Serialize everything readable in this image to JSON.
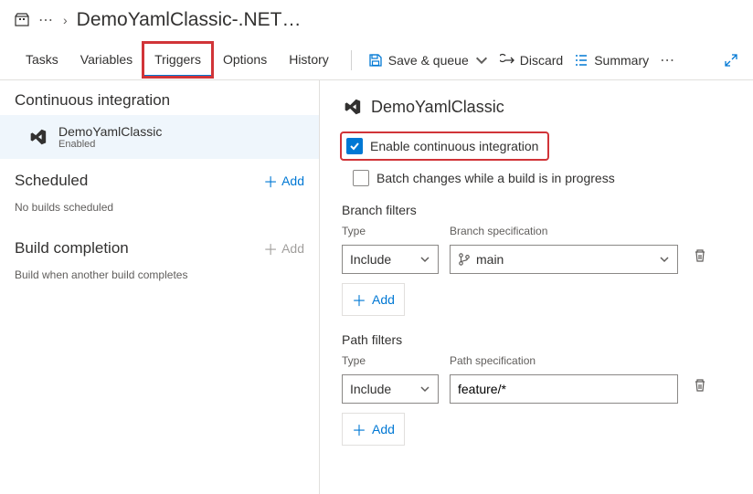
{
  "breadcrumb": {
    "title": "DemoYamlClassic-.NET…"
  },
  "tabs": [
    "Tasks",
    "Variables",
    "Triggers",
    "Options",
    "History"
  ],
  "active_tab": "Triggers",
  "toolbar": {
    "save": "Save & queue",
    "discard": "Discard",
    "summary": "Summary"
  },
  "sidebar": {
    "ci": {
      "title": "Continuous integration",
      "item": {
        "name": "DemoYamlClassic",
        "status": "Enabled"
      }
    },
    "scheduled": {
      "title": "Scheduled",
      "add": "Add",
      "hint": "No builds scheduled"
    },
    "build_completion": {
      "title": "Build completion",
      "add": "Add",
      "hint": "Build when another build completes"
    }
  },
  "content": {
    "title": "DemoYamlClassic",
    "enable_ci": "Enable continuous integration",
    "batch_changes": "Batch changes while a build is in progress",
    "branch_filters": {
      "heading": "Branch filters",
      "type_label": "Type",
      "spec_label": "Branch specification",
      "type_value": "Include",
      "branch_value": "main",
      "add": "Add"
    },
    "path_filters": {
      "heading": "Path filters",
      "type_label": "Type",
      "spec_label": "Path specification",
      "type_value": "Include",
      "path_value": "feature/*",
      "add": "Add"
    }
  }
}
